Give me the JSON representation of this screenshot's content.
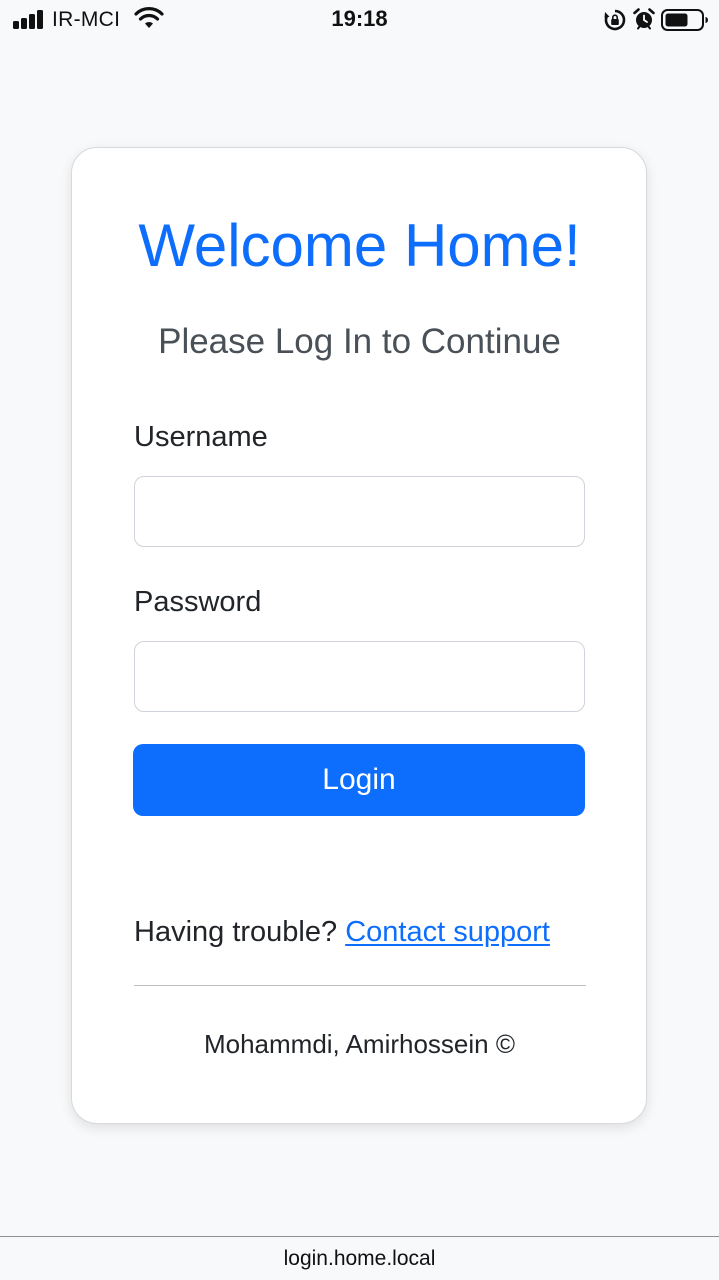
{
  "status_bar": {
    "carrier": "IR-MCI",
    "time": "19:18",
    "icons": [
      "signal-icon",
      "wifi-icon",
      "rotation-lock-icon",
      "alarm-icon",
      "battery-icon"
    ]
  },
  "login": {
    "title": "Welcome Home!",
    "subtitle": "Please Log In to Continue",
    "username_label": "Username",
    "username_value": "",
    "password_label": "Password",
    "password_value": "",
    "login_button": "Login",
    "help_text": "Having trouble?",
    "help_link": "Contact support",
    "credit": "Mohammdi, Amirhossein ©"
  },
  "browser": {
    "url": "login.home.local"
  },
  "colors": {
    "accent": "#0d6efd",
    "background": "#f8f9fa",
    "card": "#ffffff"
  }
}
